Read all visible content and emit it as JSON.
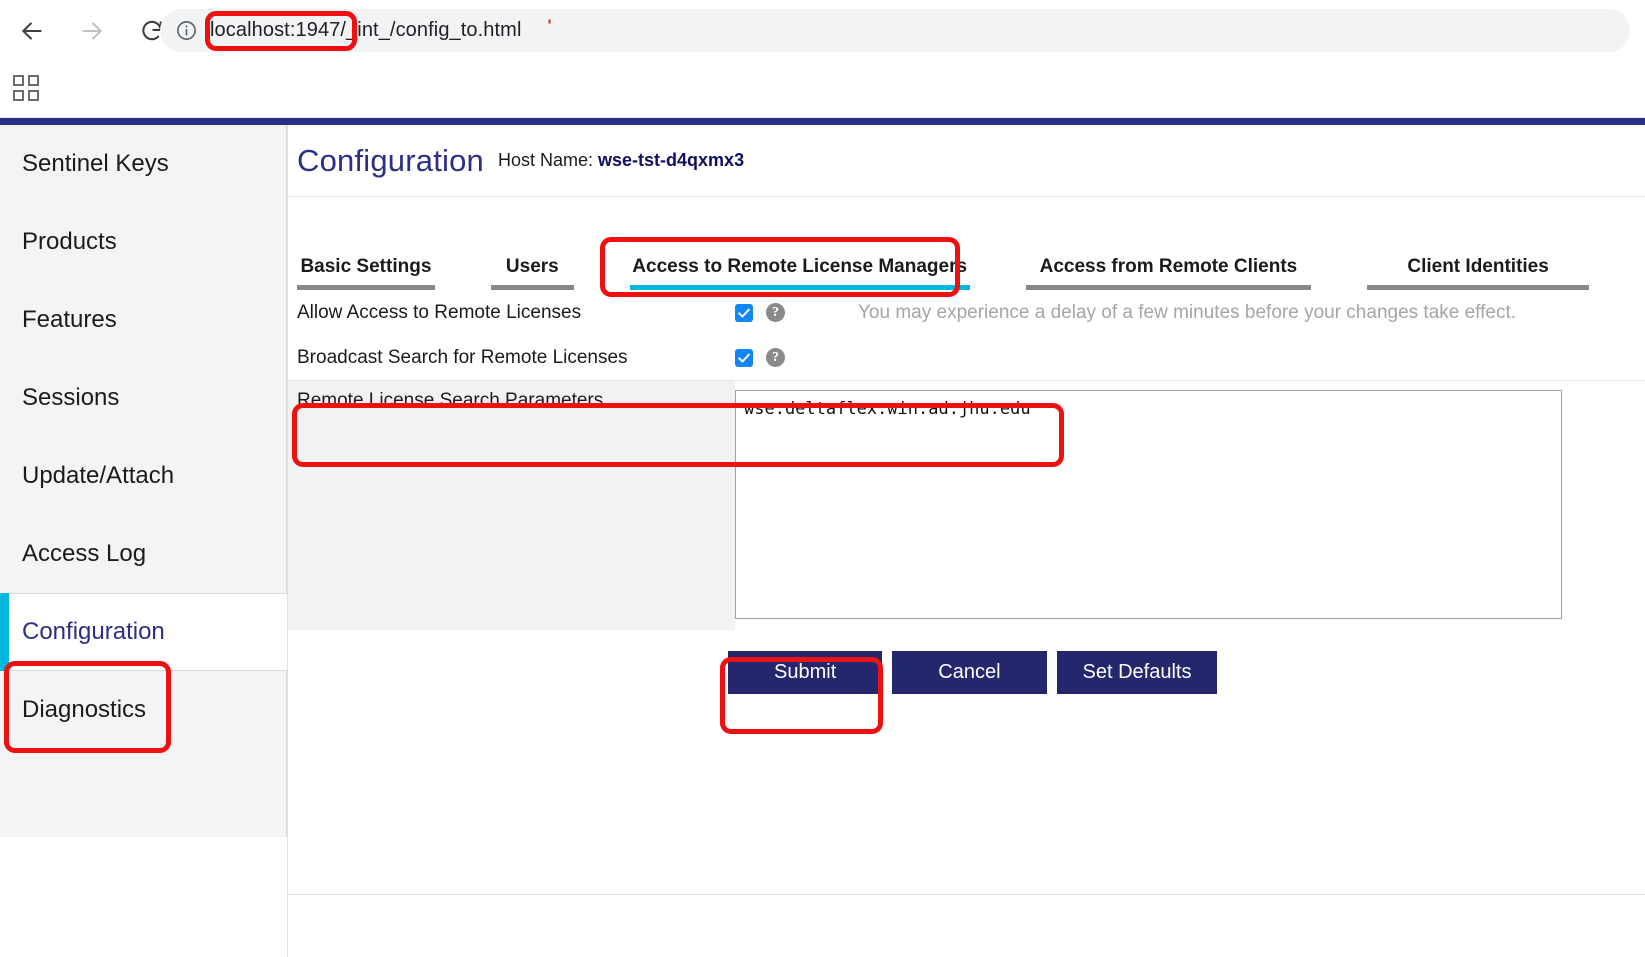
{
  "browser": {
    "back_icon": "arrow-left-icon",
    "forward_icon": "arrow-right-icon",
    "reload_icon": "reload-icon",
    "info_icon": "info-circle-icon",
    "url_host": "localhost:1947/",
    "url_path": "_int_/config_to.html",
    "text_caret": "'",
    "apps_icon": "apps-grid-icon"
  },
  "header": {
    "title": "Configuration",
    "host_name_label": "Host Name:",
    "host_name_value": "wse-tst-d4qxmx3"
  },
  "sidebar": {
    "items": [
      {
        "label": "Sentinel Keys",
        "active": false
      },
      {
        "label": "Products",
        "active": false
      },
      {
        "label": "Features",
        "active": false
      },
      {
        "label": "Sessions",
        "active": false
      },
      {
        "label": "Update/Attach",
        "active": false
      },
      {
        "label": "Access Log",
        "active": false
      },
      {
        "label": "Configuration",
        "active": true
      },
      {
        "label": "Diagnostics",
        "active": false
      }
    ]
  },
  "tabs": [
    {
      "label": "Basic Settings",
      "active": false
    },
    {
      "label": "Users",
      "active": false
    },
    {
      "label": "Access to Remote License Managers",
      "active": true
    },
    {
      "label": "Access from Remote Clients",
      "active": false
    },
    {
      "label": "Client Identities",
      "active": false
    }
  ],
  "form": {
    "allow_access_label": "Allow Access to Remote Licenses",
    "allow_access_checked": true,
    "allow_access_help": "?",
    "hint_text": "You may experience a delay of a few minutes before your changes take effect.",
    "broadcast_label": "Broadcast Search for Remote Licenses",
    "broadcast_checked": true,
    "broadcast_help": "?",
    "params_label": "Remote License Search Parameters",
    "params_value": "wse.deltaflex.win.ad.jhu.edu",
    "params_placeholder": ""
  },
  "buttons": {
    "submit": "Submit",
    "cancel": "Cancel",
    "set_defaults": "Set Defaults"
  },
  "colors": {
    "brand_navy": "#2b3087",
    "accent_cyan": "#00b7e0",
    "checkbox_blue": "#1285f7",
    "button_navy": "#25276d",
    "annotation_red": "#ee1111",
    "hint_gray": "#a5a5a5"
  }
}
